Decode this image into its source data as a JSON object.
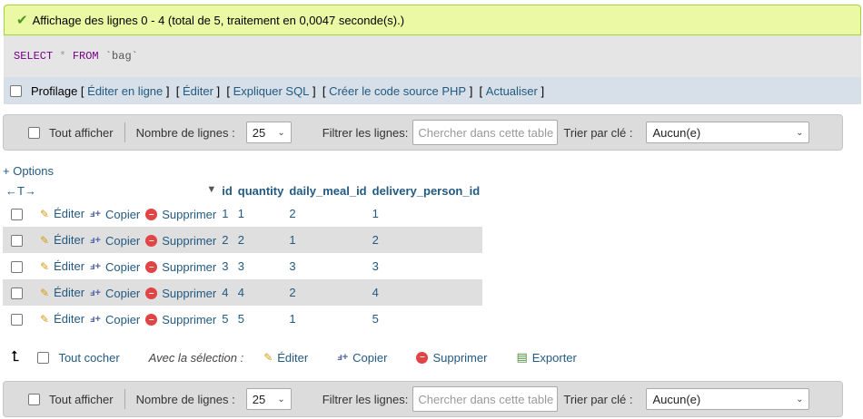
{
  "success": {
    "message": "Affichage des lignes 0 - 4 (total de 5, traitement en 0,0047 seconde(s).)"
  },
  "sql": {
    "select": "SELECT",
    "star": "*",
    "from": "FROM",
    "table": "`bag`"
  },
  "sql_options": {
    "profiling": "Profilage",
    "links": [
      "Éditer en ligne",
      "Éditer",
      "Expliquer SQL",
      "Créer le code source PHP",
      "Actualiser"
    ]
  },
  "nav": {
    "show_all": "Tout afficher",
    "rows_label": "Nombre de lignes :",
    "rows_value": "25",
    "filter_label": "Filtrer les lignes:",
    "filter_placeholder": "Chercher dans cette table",
    "sort_label": "Trier par clé :",
    "sort_value": "Aucun(e)"
  },
  "options_link": "+ Options",
  "table": {
    "arrows": "←T→",
    "columns": [
      "id",
      "quantity",
      "daily_meal_id",
      "delivery_person_id"
    ],
    "actions": {
      "edit": "Éditer",
      "copy": "Copier",
      "delete": "Supprimer"
    },
    "rows": [
      {
        "id": "1",
        "quantity": "1",
        "daily_meal_id": "2",
        "delivery_person_id": "1"
      },
      {
        "id": "2",
        "quantity": "2",
        "daily_meal_id": "1",
        "delivery_person_id": "2"
      },
      {
        "id": "3",
        "quantity": "3",
        "daily_meal_id": "3",
        "delivery_person_id": "3"
      },
      {
        "id": "4",
        "quantity": "4",
        "daily_meal_id": "2",
        "delivery_person_id": "4"
      },
      {
        "id": "5",
        "quantity": "5",
        "daily_meal_id": "1",
        "delivery_person_id": "5"
      }
    ]
  },
  "bulk": {
    "check_all": "Tout cocher",
    "with_selection": "Avec la sélection :",
    "edit": "Éditer",
    "copy": "Copier",
    "delete": "Supprimer",
    "export": "Exporter"
  }
}
